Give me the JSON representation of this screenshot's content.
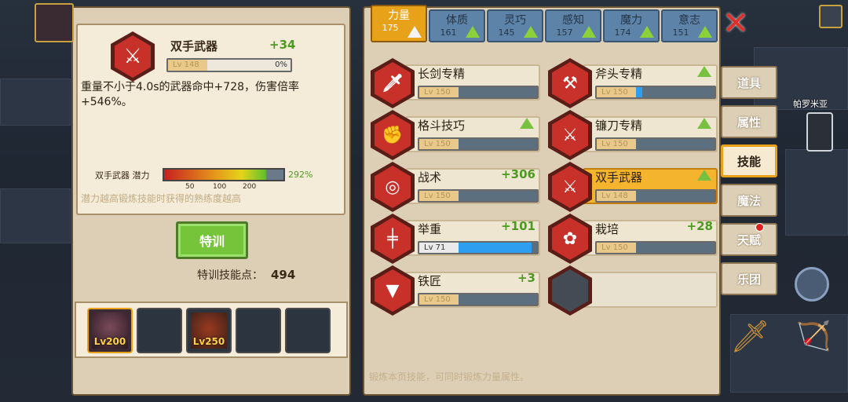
{
  "detail": {
    "title": "双手武器",
    "bonus": "+34",
    "level": "Lv 148",
    "progress_label": "0%",
    "progress": 0,
    "description": "重量不小于4.0s的武器命中+728，伤害倍率+546%。",
    "potential_label": "双手武器 潜力",
    "potential_pct": "292%",
    "ticks": [
      "50",
      "100",
      "200"
    ],
    "hint": "潜力越高锻炼技能时获得的熟练度越高",
    "icon": "two-hand-sword-icon"
  },
  "train_button": "特训",
  "train_points_label": "特训技能点：",
  "train_points": "494",
  "slots": [
    {
      "level": "Lv200",
      "selected": true
    },
    {
      "level": "",
      "selected": false
    },
    {
      "level": "Lv250",
      "selected": false
    },
    {
      "level": "",
      "selected": false
    },
    {
      "level": "",
      "selected": false
    }
  ],
  "tabs": [
    {
      "name": "力量",
      "value": "175",
      "active": true
    },
    {
      "name": "体质",
      "value": "161"
    },
    {
      "name": "灵巧",
      "value": "145"
    },
    {
      "name": "感知",
      "value": "157"
    },
    {
      "name": "魔力",
      "value": "174"
    },
    {
      "name": "意志",
      "value": "151"
    }
  ],
  "skills": [
    {
      "name": "长剑专精",
      "level": "Lv 150",
      "fill": 0,
      "bonus": "",
      "up": false,
      "icon": "sword-icon"
    },
    {
      "name": "斧头专精",
      "level": "Lv 150",
      "fill": 0.08,
      "bonus": "",
      "up": true,
      "icon": "axe-icon"
    },
    {
      "name": "格斗技巧",
      "level": "Lv 150",
      "fill": 0,
      "bonus": "",
      "up": true,
      "icon": "fist-icon"
    },
    {
      "name": "镰刀专精",
      "level": "Lv 150",
      "fill": 0,
      "bonus": "",
      "up": true,
      "icon": "scythe-icon"
    },
    {
      "name": "战术",
      "level": "Lv 150",
      "fill": 0,
      "bonus": "+306",
      "up": false,
      "icon": "tactics-icon"
    },
    {
      "name": "双手武器",
      "level": "Lv 148",
      "fill": 0,
      "bonus": "",
      "up": true,
      "icon": "two-hand-sword-icon",
      "selected": true
    },
    {
      "name": "举重",
      "level": "Lv 71",
      "fill": 0.93,
      "bonus": "+101",
      "up": false,
      "icon": "barbell-icon"
    },
    {
      "name": "栽培",
      "level": "Lv 150",
      "fill": 0,
      "bonus": "+28",
      "up": false,
      "icon": "plant-icon"
    },
    {
      "name": "铁匠",
      "level": "Lv 150",
      "fill": 0,
      "bonus": "+3",
      "up": false,
      "icon": "anvil-icon"
    },
    {
      "name": "",
      "level": "",
      "fill": 0,
      "bonus": "",
      "up": false,
      "icon": "empty-slot",
      "empty": true
    }
  ],
  "footer": "锻炼本页技能，可同时锻炼力量属性。",
  "side_menu": [
    "道具",
    "属性",
    "技能",
    "魔法",
    "天赋",
    "乐团"
  ],
  "side_active": "技能",
  "map_label": "帕罗米亚",
  "colors": {
    "accent": "#e8a21a",
    "skill_red": "#c8302a",
    "positive": "#4d9a22"
  }
}
